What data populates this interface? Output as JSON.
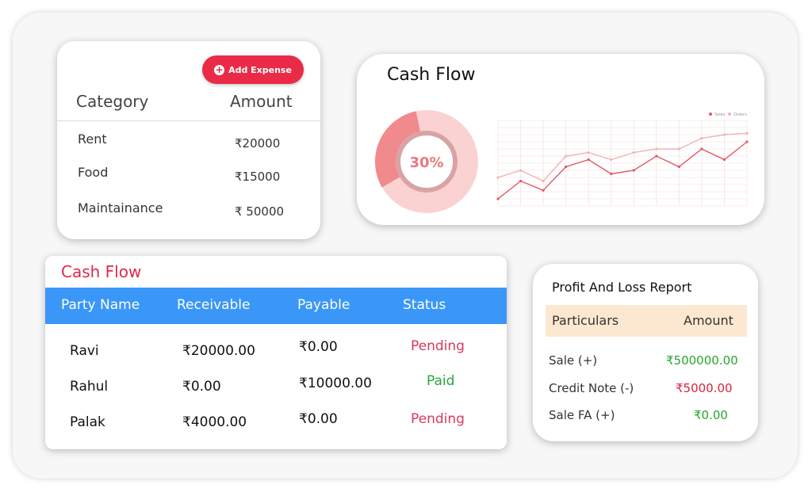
{
  "expense": {
    "add_button_label": "Add Expense",
    "headers": {
      "category": "Category",
      "amount": "Amount"
    },
    "rows": [
      {
        "category": "Rent",
        "amount": "₹20000"
      },
      {
        "category": "Food",
        "amount": "₹15000"
      },
      {
        "category": "Maintainance",
        "amount": "₹ 50000"
      }
    ]
  },
  "chart_card": {
    "title": "Cash Flow",
    "donut_label": "30%",
    "legend": [
      "Sales",
      "Orders"
    ]
  },
  "chart_data": {
    "type": "line",
    "x": [
      1,
      2,
      3,
      4,
      5,
      6,
      7,
      8,
      9,
      10,
      11,
      12
    ],
    "ylim": [
      0,
      12
    ],
    "grid": true,
    "legend": "top-right",
    "series": [
      {
        "name": "Sales",
        "values": [
          1,
          3.5,
          2.2,
          5.5,
          6.5,
          4.5,
          5,
          7,
          5.5,
          8,
          6.5,
          9
        ]
      },
      {
        "name": "Orders",
        "values": [
          4,
          5,
          3.5,
          7,
          7.5,
          6.5,
          7.5,
          8,
          8,
          9.5,
          10,
          10.2
        ]
      }
    ],
    "donut_percent": 30,
    "colors": {
      "sales": "#e25a63",
      "orders": "#f2b3b6",
      "donut": "#f08a8c",
      "donut_light": "#fbd2d2"
    }
  },
  "cashflow": {
    "title": "Cash Flow",
    "headers": {
      "party": "Party Name",
      "receivable": "Receivable",
      "payable": "Payable",
      "status": "Status"
    },
    "rows": [
      {
        "party": "Ravi",
        "receivable": "₹20000.00",
        "payable": "₹0.00",
        "status": "Pending"
      },
      {
        "party": "Rahul",
        "receivable": "₹0.00",
        "payable": "₹10000.00",
        "status": "Paid"
      },
      {
        "party": "Palak",
        "receivable": "₹4000.00",
        "payable": "₹0.00",
        "status": "Pending"
      }
    ],
    "colors": {
      "header": "#3a97f7",
      "title": "#e0294a"
    }
  },
  "pl": {
    "title": "Profit And Loss Report",
    "headers": {
      "particulars": "Particulars",
      "amount": "Amount"
    },
    "rows": [
      {
        "label": "Sale (+)",
        "amount": "₹500000.00"
      },
      {
        "label": "Credit Note (-)",
        "amount": "₹5000.00"
      },
      {
        "label": "Sale FA (+)",
        "amount": "₹0.00"
      }
    ]
  }
}
